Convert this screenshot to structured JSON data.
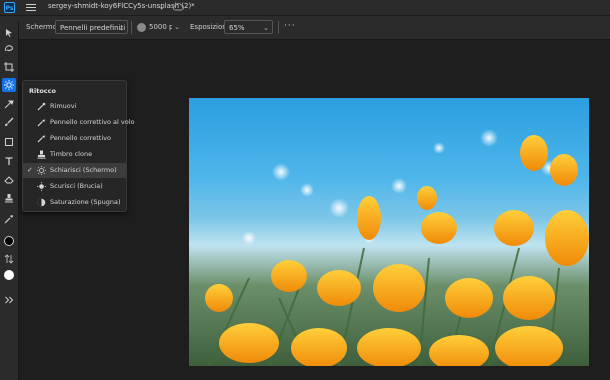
{
  "app": {
    "logo_text": "Ps"
  },
  "document": {
    "title": "sergey-shmidt-koy6FlCCy5s-unsplash (2)*"
  },
  "options_bar": {
    "tool_label": "Schermo",
    "preset": "Pennelli predefiniti",
    "brush_size": "5000 px",
    "exposure_label": "Esposizione",
    "exposure_value": "65%",
    "more": "···"
  },
  "tools": [
    {
      "icon": "move-icon"
    },
    {
      "icon": "lasso-icon"
    },
    {
      "icon": "crop-icon"
    },
    {
      "icon": "dodge-icon",
      "active": true
    },
    {
      "icon": "spot-healing-icon"
    },
    {
      "icon": "brush-icon"
    },
    {
      "icon": "rectangle-icon"
    },
    {
      "icon": "type-icon"
    },
    {
      "icon": "eraser-icon"
    },
    {
      "icon": "clone-stamp-icon"
    },
    {
      "icon": "eyedropper-icon"
    }
  ],
  "colors": {
    "foreground": "#000000",
    "background": "#ffffff",
    "accent": "#1473e6"
  },
  "flyout": {
    "title": "Ritocco",
    "items": [
      {
        "label": "Rimuovi",
        "icon": "remove-icon"
      },
      {
        "label": "Pennello correttivo al volo",
        "icon": "spot-healing-icon"
      },
      {
        "label": "Pennello correttivo",
        "icon": "healing-brush-icon"
      },
      {
        "label": "Timbro clone",
        "icon": "clone-stamp-icon"
      },
      {
        "label": "Schiarisci (Schermo)",
        "icon": "dodge-icon",
        "selected": true,
        "check": "✓"
      },
      {
        "label": "Scurisci (Brucia)",
        "icon": "burn-icon"
      },
      {
        "label": "Saturazione (Spugna)",
        "icon": "sponge-icon"
      }
    ]
  }
}
